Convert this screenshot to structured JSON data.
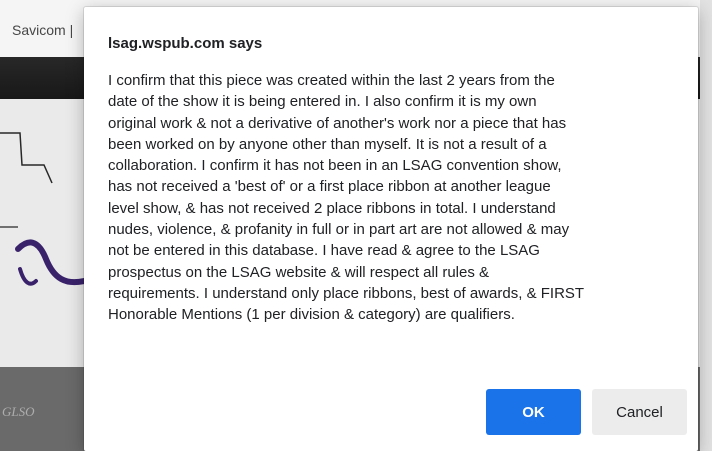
{
  "background": {
    "header_text": "Savicom |",
    "footer_logo_text": "GLSO"
  },
  "dialog": {
    "title": "lsag.wspub.com says",
    "message_lines": [
      "I confirm that this piece was created within the last 2 years from the",
      "date of the show it is being entered in.  I also confirm it is my own",
      "original work & not a derivative of another's work nor a piece that has",
      "been worked on by anyone other than myself.  It is not a result of a",
      "collaboration.  I confirm it has not been in an LSAG convention show,",
      "has not received a 'best of' or a first place ribbon at another league",
      "level show, & has not received 2 place ribbons in total.  I understand",
      "nudes, violence, & profanity in full or in part art are not allowed & may",
      "not be entered in this database.  I have read & agree to the LSAG",
      "prospectus on the LSAG website & will respect all rules &",
      "requirements.  I understand only place ribbons, best of awards, & FIRST",
      "Honorable Mentions (1 per division & category) are qualifiers."
    ],
    "ok_label": "OK",
    "cancel_label": "Cancel"
  },
  "colors": {
    "primary_button": "#1a73e8",
    "secondary_button": "#ececec",
    "text": "#202124",
    "art_stroke": "#3d2470"
  }
}
